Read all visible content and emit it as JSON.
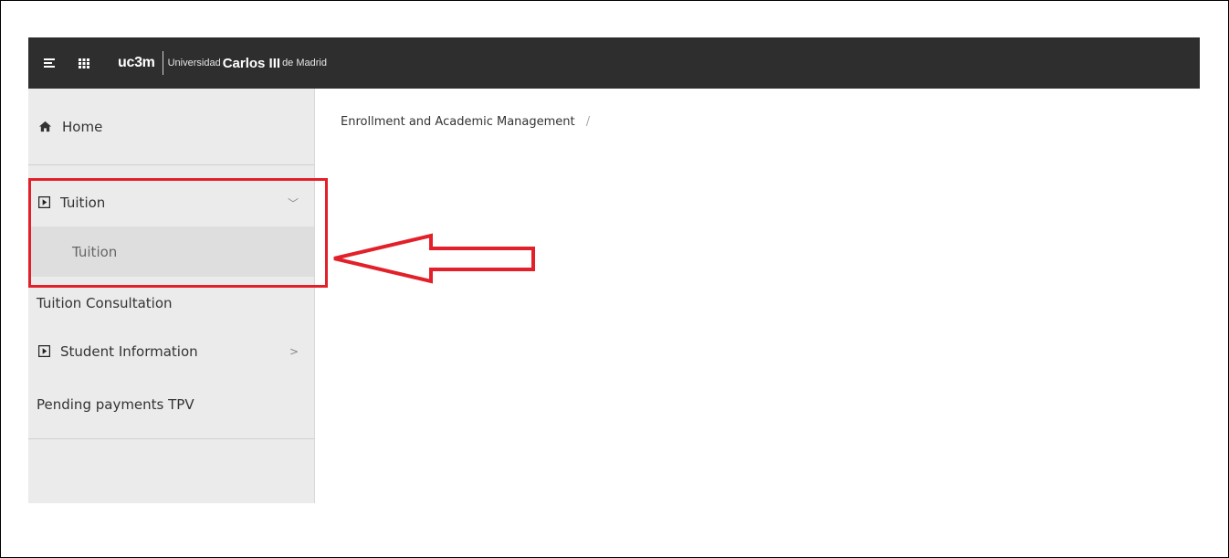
{
  "topbar": {
    "menu_icon": "hamburger-icon",
    "apps_icon": "grid-apps-icon",
    "logo": {
      "brand": "uc3m",
      "universidad": "Universidad",
      "name": "Carlos III",
      "suffix": "de Madrid"
    }
  },
  "sidebar": {
    "home": {
      "icon": "home-icon",
      "label": "Home"
    },
    "tuition_group": {
      "icon": "collapse-box-icon",
      "label": "Tuition",
      "expanded": true
    },
    "tuition_sub": {
      "label": "Tuition"
    },
    "tuition_consultation": {
      "label": "Tuition Consultation"
    },
    "student_info": {
      "icon": "collapse-box-icon",
      "label": "Student Information",
      "expanded": false
    },
    "pending_payments": {
      "label": "Pending payments TPV"
    }
  },
  "breadcrumb": {
    "item": "Enrollment and Academic Management",
    "separator": "/"
  },
  "annotation": {
    "color": "#e3202a"
  }
}
